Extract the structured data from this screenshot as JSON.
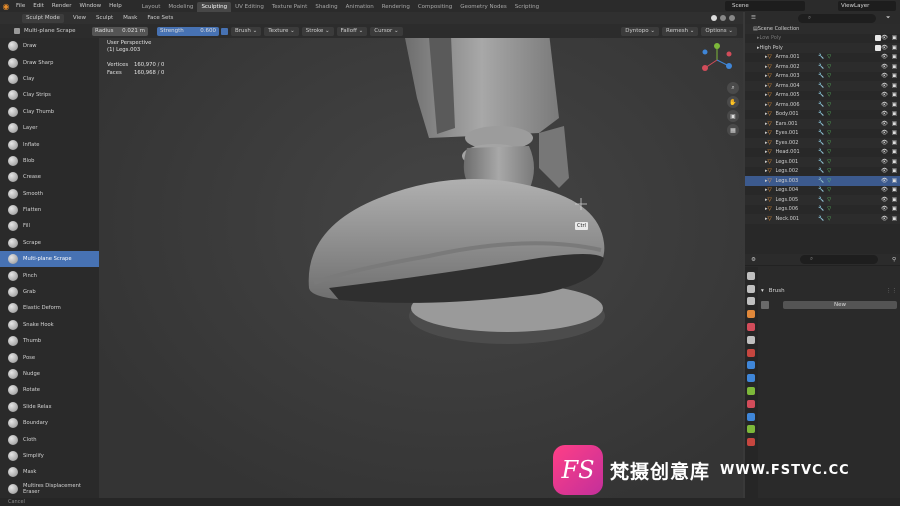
{
  "menubar": {
    "items": [
      "File",
      "Edit",
      "Render",
      "Window",
      "Help"
    ],
    "workspaces": [
      "Layout",
      "Modeling",
      "Sculpting",
      "UV Editing",
      "Texture Paint",
      "Shading",
      "Animation",
      "Rendering",
      "Compositing",
      "Geometry Nodes",
      "Scripting"
    ],
    "active_workspace": "Sculpting",
    "scene": "Scene",
    "view_layer": "ViewLayer"
  },
  "header": {
    "mode": "Sculpt Mode",
    "menus": [
      "View",
      "Sculpt",
      "Mask",
      "Face Sets"
    ]
  },
  "toolsettings": {
    "tool": "Multi-plane Scrape",
    "radius_label": "Radius",
    "radius_value": "0.021 m",
    "strength_label": "Strength",
    "strength_value": "0.600",
    "menus": [
      "Brush",
      "Texture",
      "Stroke",
      "Falloff",
      "Cursor"
    ],
    "right": [
      "Dyntopo",
      "Remesh",
      "Options"
    ]
  },
  "viewport": {
    "view_name": "User Perspective",
    "object": "(1) Legs.003",
    "vertices_label": "Vertices",
    "vertices": "160,970 / 0",
    "faces_label": "Faces",
    "faces": "160,968 / 0",
    "tooltip": "Ctrl"
  },
  "tools": [
    "Draw",
    "Draw Sharp",
    "Clay",
    "Clay Strips",
    "Clay Thumb",
    "Layer",
    "Inflate",
    "Blob",
    "Crease",
    "Smooth",
    "Flatten",
    "Fill",
    "Scrape",
    "Multi-plane Scrape",
    "Pinch",
    "Grab",
    "Elastic Deform",
    "Snake Hook",
    "Thumb",
    "Pose",
    "Nudge",
    "Rotate",
    "Slide Relax",
    "Boundary",
    "Cloth",
    "Simplify",
    "Mask",
    "Multires Displacement Eraser"
  ],
  "active_tool": "Multi-plane Scrape",
  "outliner": {
    "root": "Scene Collection",
    "collections": [
      {
        "name": "Low Poly",
        "dim": true
      },
      {
        "name": "High Poly",
        "dim": false
      }
    ],
    "objects": [
      "Arms.001",
      "Arms.002",
      "Arms.003",
      "Arms.004",
      "Arms.005",
      "Arms.006",
      "Body.001",
      "Ears.001",
      "Eyes.001",
      "Eyes.002",
      "Head.001",
      "Legs.001",
      "Legs.002",
      "Legs.003",
      "Legs.004",
      "Legs.005",
      "Legs.006",
      "Neck.001"
    ],
    "selected": "Legs.003"
  },
  "properties": {
    "panel": "Brush",
    "new_button": "New"
  },
  "statusbar": {
    "text": "Cancel"
  },
  "watermark": {
    "logo": "FS",
    "cn": "梵摄创意库",
    "url": "WWW.FSTVC.CC"
  },
  "colors": {
    "accent": "#4772b3",
    "orange": "#e88d2a",
    "watermark": "#ff3f86"
  }
}
